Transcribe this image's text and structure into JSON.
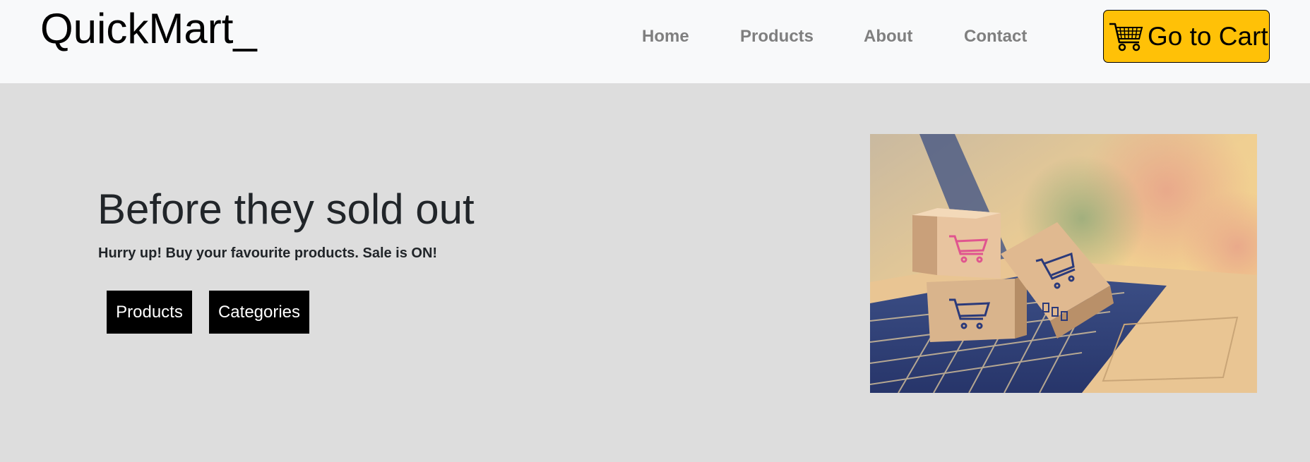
{
  "brand": {
    "name": "QuickMart_"
  },
  "nav": {
    "items": [
      {
        "label": "Home"
      },
      {
        "label": "Products"
      },
      {
        "label": "About"
      },
      {
        "label": "Contact"
      }
    ],
    "cart_button": {
      "label": "Go to Cart",
      "icon": "shopping-cart-icon",
      "color": "#ffc107"
    }
  },
  "hero": {
    "title": "Before they sold out",
    "subtitle": "Hurry up! Buy your favourite products. Sale is ON!",
    "buttons": [
      {
        "label": "Products"
      },
      {
        "label": "Categories"
      }
    ],
    "image": {
      "subject": "cardboard-boxes-with-cart-logos-on-laptop-keyboard"
    }
  },
  "colors": {
    "navbar_bg": "#f8f9fa",
    "page_bg": "#dddddd",
    "nav_link": "#7f7f7f",
    "accent": "#ffc107",
    "hero_button_bg": "#000000"
  }
}
